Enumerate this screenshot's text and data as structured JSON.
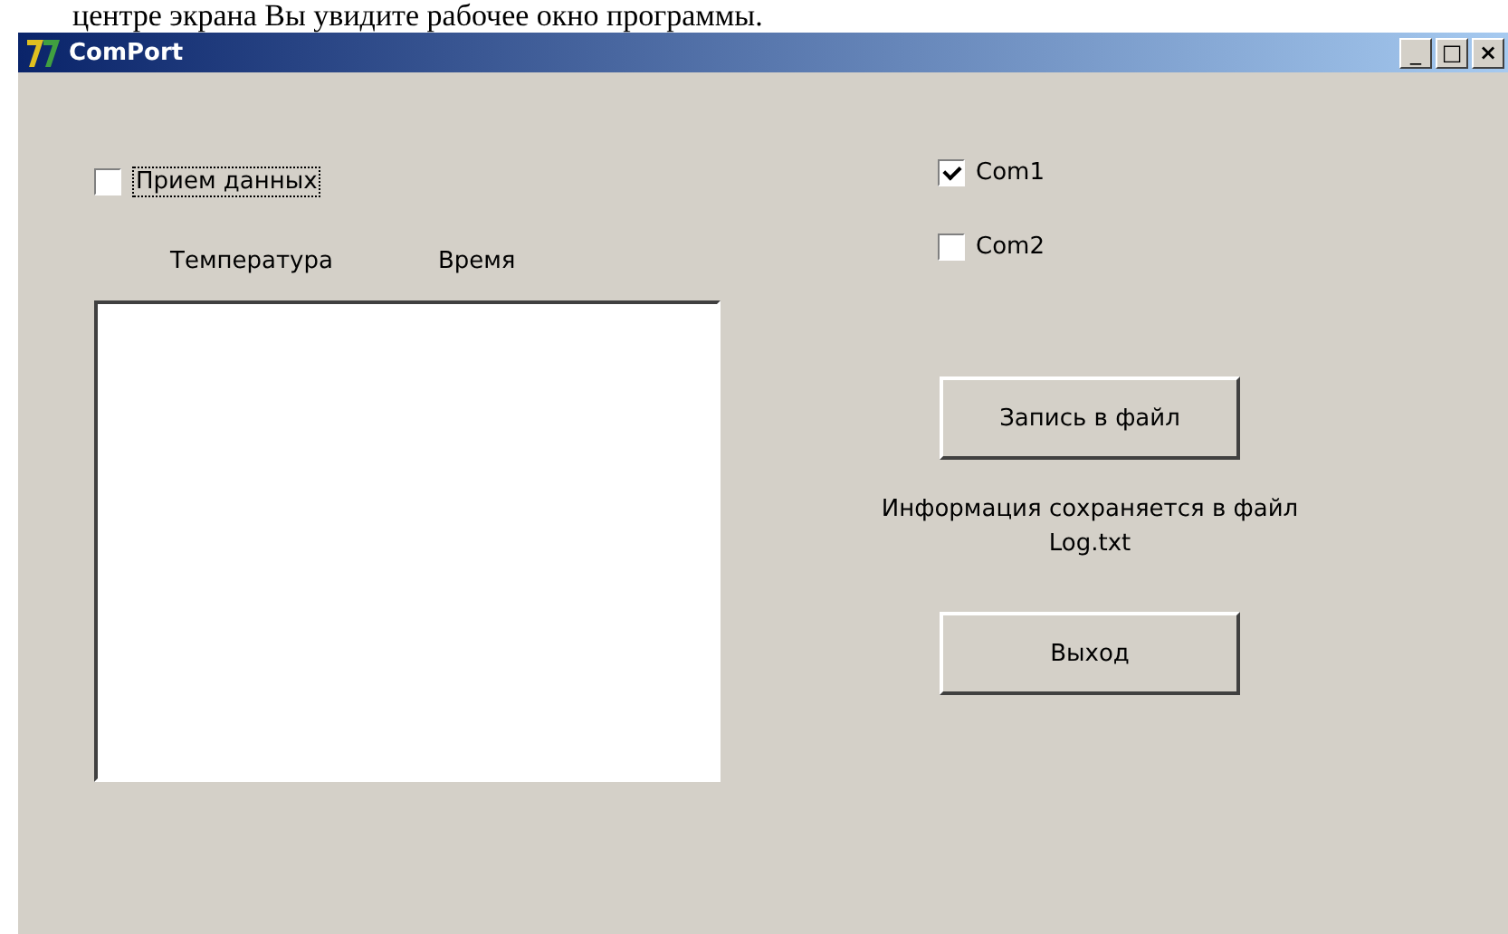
{
  "document_text": "центре экрана Вы увидите рабочее окно программы.",
  "window": {
    "title": "ComPort",
    "controls": [
      "_",
      "□",
      "×"
    ]
  },
  "receive_checkbox": {
    "label": "Прием данных",
    "checked": false
  },
  "list": {
    "columns": [
      "Температура",
      "Время"
    ]
  },
  "ports": [
    {
      "label": "Com1",
      "checked": true
    },
    {
      "label": "Com2",
      "checked": false
    }
  ],
  "save_button": "Запись в файл",
  "info": [
    "Информация сохраняется в файл",
    "Log.txt"
  ],
  "exit_button": "Выход"
}
